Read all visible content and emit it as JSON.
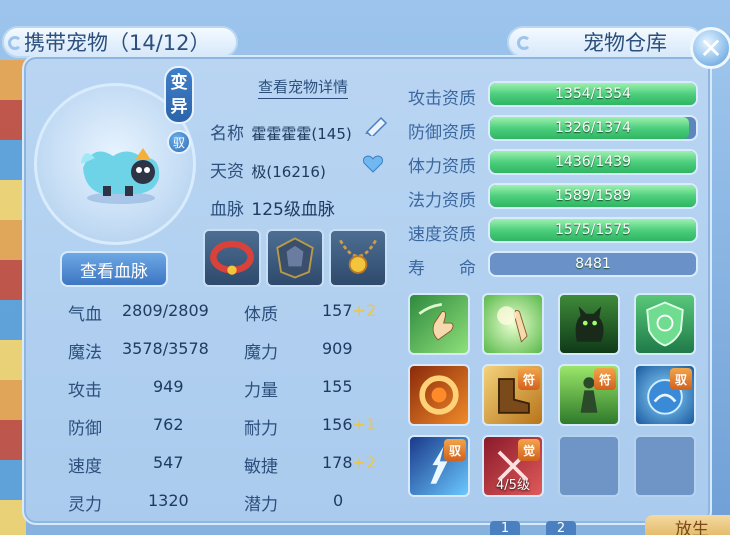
{
  "tabs": {
    "carry": "携带宠物（14/12）",
    "warehouse": "宠物仓库"
  },
  "icons": {
    "close": "close-icon",
    "edit": "pencil-icon",
    "favorite": "heart-icon"
  },
  "pet": {
    "variant_label": "变异",
    "badge": "驭",
    "detail_link": "查看宠物详情",
    "name_label": "名称",
    "name_value": "霍霍霍霍(145)",
    "talent_label": "天资",
    "talent_value": "极(16216)",
    "bloodline_label": "血脉",
    "bloodline_value": "125级血脉",
    "view_bloodline_button": "查看血脉"
  },
  "stats": [
    {
      "label": "气血",
      "value": "2809/2809"
    },
    {
      "label": "魔法",
      "value": "3578/3578"
    },
    {
      "label": "攻击",
      "value": "949"
    },
    {
      "label": "防御",
      "value": "762"
    },
    {
      "label": "速度",
      "value": "547"
    },
    {
      "label": "灵力",
      "value": "1320"
    }
  ],
  "attributes": [
    {
      "label": "体质",
      "value": "157",
      "bonus": "+2"
    },
    {
      "label": "魔力",
      "value": "909",
      "bonus": ""
    },
    {
      "label": "力量",
      "value": "155",
      "bonus": ""
    },
    {
      "label": "耐力",
      "value": "156",
      "bonus": "+1"
    },
    {
      "label": "敏捷",
      "value": "178",
      "bonus": "+2"
    },
    {
      "label": "潜力",
      "value": "0",
      "bonus": ""
    }
  ],
  "aptitudes": [
    {
      "label": "攻击资质",
      "text": "1354/1354",
      "fill": 1.0
    },
    {
      "label": "防御资质",
      "text": "1326/1374",
      "fill": 0.965
    },
    {
      "label": "体力资质",
      "text": "1436/1439",
      "fill": 0.998
    },
    {
      "label": "法力资质",
      "text": "1589/1589",
      "fill": 1.0
    },
    {
      "label": "速度资质",
      "text": "1575/1575",
      "fill": 1.0
    }
  ],
  "lifespan": {
    "label": "寿　　命",
    "value": "8481"
  },
  "skills": [
    {
      "name": "skill-1",
      "corner": "",
      "level": ""
    },
    {
      "name": "skill-2",
      "corner": "",
      "level": ""
    },
    {
      "name": "skill-3",
      "corner": "",
      "level": ""
    },
    {
      "name": "skill-4",
      "corner": "",
      "level": ""
    },
    {
      "name": "skill-5",
      "corner": "",
      "level": ""
    },
    {
      "name": "skill-6",
      "corner": "符",
      "level": ""
    },
    {
      "name": "skill-7",
      "corner": "符",
      "level": ""
    },
    {
      "name": "skill-8",
      "corner": "驭",
      "level": ""
    },
    {
      "name": "skill-9",
      "corner": "驭",
      "level": ""
    },
    {
      "name": "skill-10",
      "corner": "觉",
      "level": "4/5级"
    }
  ],
  "pager": [
    "1",
    "2"
  ],
  "release_label": "放生",
  "colors": {
    "accent": "#3d76c2",
    "bar_fill": "#4dcf7d",
    "bonus": "#f2c53a"
  }
}
